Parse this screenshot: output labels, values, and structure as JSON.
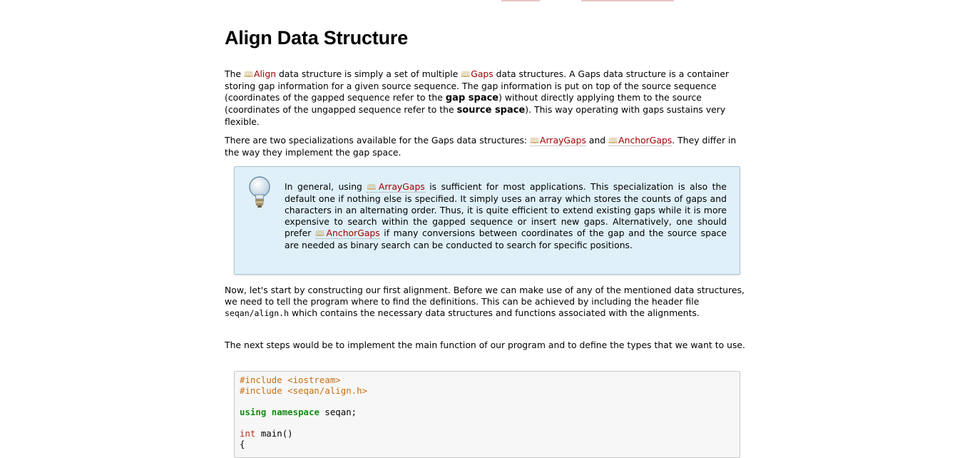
{
  "heading": "Align Data Structure",
  "para1": {
    "t1": "The ",
    "link_align": "Align",
    "t2": " data structure is simply a set of multiple ",
    "link_gaps": "Gaps",
    "t3": " data structures. A Gaps data structure is a container storing gap information for a given source sequence. The gap information is put on top of the source sequence (coordinates of the gapped sequence refer to the ",
    "b1": "gap space",
    "t4": ") without directly applying them to the source (coordinates of the ungapped sequence refer to the ",
    "b2": "source space",
    "t5": "). This way operating with gaps sustains very flexible."
  },
  "para2": {
    "t1": "There are two specializations available for the Gaps data structures: ",
    "link_arraygaps": "ArrayGaps",
    "t2": " and ",
    "link_anchorgaps": "AnchorGaps",
    "t3": ". They differ in the way they implement the gap space."
  },
  "note": {
    "t1": "In general, using ",
    "link_arraygaps": "ArrayGaps",
    "t2": " is sufficient for most applications. This specialization is also the default one if nothing else is specified. It simply uses an array which stores the counts of gaps and characters in an alternating order. Thus, it is quite efficient to extend existing gaps while it is more expensive to search within the gapped sequence or insert new gaps. Alternatively, one should prefer ",
    "link_anchorgaps": "AnchorGaps",
    "t3": " if many conversions between coordinates of the gap and the source space are needed as binary search can be conducted to search for specific positions."
  },
  "para3": {
    "t1": "Now, let's start by constructing our first alignment. Before we can make use of any of the mentioned data structures, we need to tell the program where to find the definitions. This can be achieved by including the header file ",
    "code": "seqan/align.h",
    "t2": " which contains the necessary data structures and functions associated with the alignments."
  },
  "para4": "The next steps would be to implement the main function of our program and to define the types that we want to use.",
  "code": {
    "line1": "#include <iostream>",
    "line2": "#include <seqan/align.h>",
    "line3_kw1": "using",
    "line3_kw2": "namespace",
    "line3_rest": " seqan;",
    "line4_type": "int",
    "line4_rest": " main()",
    "line5": "{"
  },
  "colors": {
    "link": "#a40000",
    "note_bg": "#dff0f8",
    "preprocessor": "#c66f13",
    "keyword": "#1a8a1a",
    "type": "#b4321e"
  }
}
